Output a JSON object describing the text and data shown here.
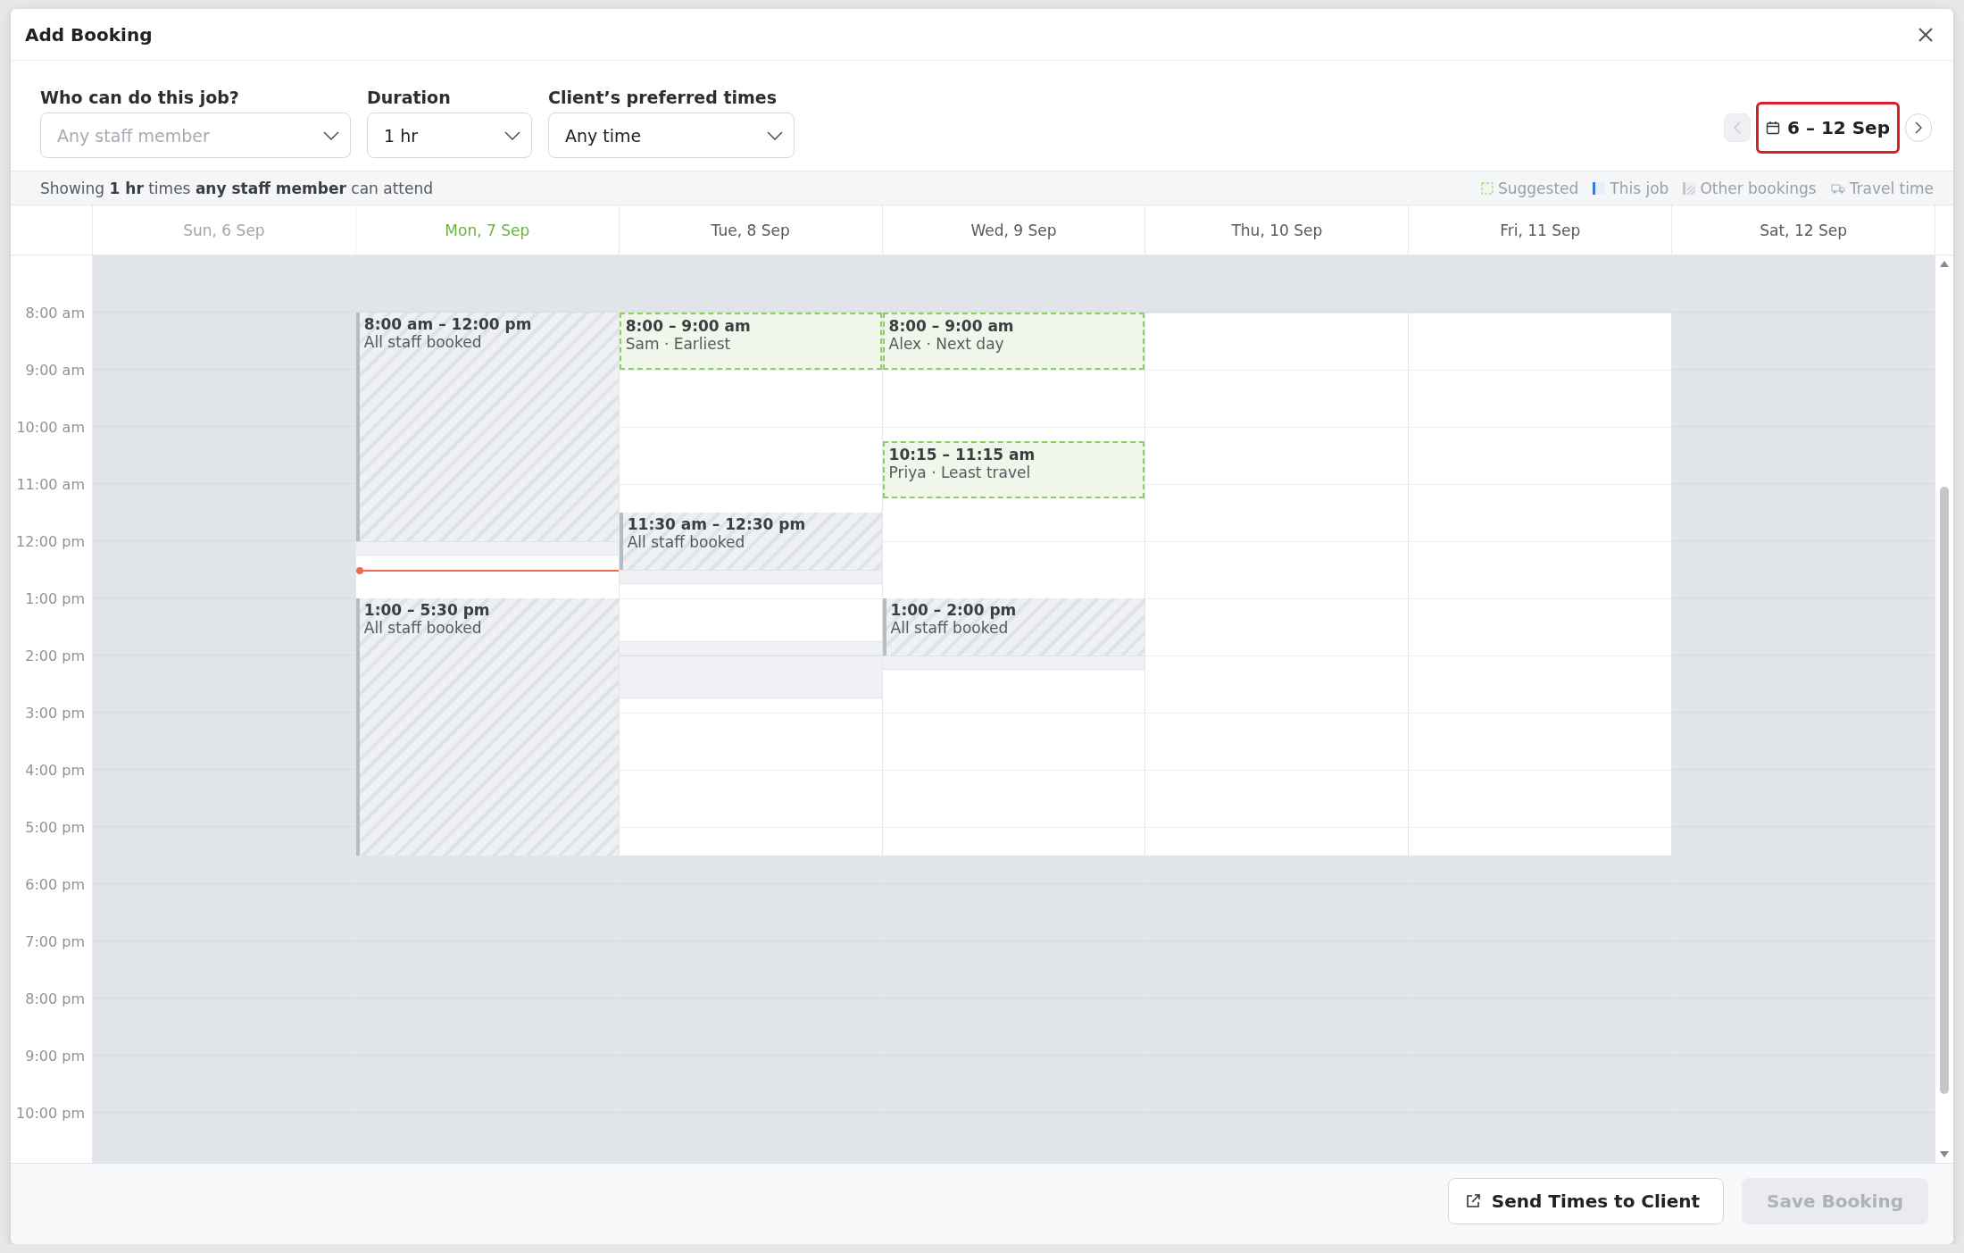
{
  "window": {
    "title": "Add Booking"
  },
  "filters": [
    {
      "kind": "select",
      "label": "Who can do this job?",
      "placeholder": "Any staff member"
    },
    {
      "kind": "select",
      "label": "Duration",
      "value": "1 hr"
    },
    {
      "kind": "select",
      "label": "Client’s preferred times",
      "value": "Any time"
    }
  ],
  "date_nav": {
    "range": "6 – 12 Sep",
    "prev_disabled": true,
    "highlighted": true
  },
  "info": "Showing **1 hr** times **any staff member** can attend",
  "legend": [
    {
      "kind": "suggested",
      "label": "Suggested"
    },
    {
      "kind": "this_job",
      "label": "This job"
    },
    {
      "kind": "other",
      "label": "Other bookings"
    },
    {
      "kind": "travel",
      "label": "Travel time"
    }
  ],
  "times": [
    "8:00 am",
    "9:00 am",
    "10:00 am",
    "11:00 am",
    "12:00 pm",
    "1:00 pm",
    "2:00 pm",
    "3:00 pm",
    "4:00 pm",
    "5:00 pm",
    "6:00 pm",
    "7:00 pm",
    "8:00 pm",
    "9:00 pm",
    "10:00 pm"
  ],
  "days": [
    {
      "label": "Sun, 6 Sep",
      "past": true,
      "today": false,
      "working": false
    },
    {
      "label": "Mon, 7 Sep",
      "past": false,
      "today": true,
      "working": true,
      "events": [
        {
          "kind": "booked",
          "time": "8:00 am – 12:00 pm",
          "text": "All staff booked"
        },
        {
          "kind": "travel"
        },
        {
          "kind": "now"
        },
        {
          "kind": "booked",
          "time": "1:00 – 5:30 pm",
          "text": "All staff booked"
        }
      ]
    },
    {
      "label": "Tue, 8 Sep",
      "past": false,
      "today": false,
      "working": true,
      "events": [
        {
          "kind": "suggested",
          "time": "8:00 – 9:00 am",
          "text": "Sam · Earliest"
        },
        {
          "kind": "booked",
          "time": "11:30 am – 12:30 pm",
          "text": "All staff booked"
        },
        {
          "kind": "travel"
        },
        {
          "kind": "travel"
        },
        {
          "kind": "travel"
        }
      ]
    },
    {
      "label": "Wed, 9 Sep",
      "past": false,
      "today": false,
      "working": true,
      "events": [
        {
          "kind": "suggested",
          "time": "8:00 – 9:00 am",
          "text": "Alex · Next day"
        },
        {
          "kind": "suggested",
          "time": "10:15 – 11:15 am",
          "text": "Priya · Least travel"
        },
        {
          "kind": "booked",
          "time": "1:00 – 2:00 pm",
          "text": "All staff booked"
        },
        {
          "kind": "travel"
        }
      ]
    },
    {
      "label": "Thu, 10 Sep",
      "past": false,
      "today": false,
      "working": true
    },
    {
      "label": "Fri, 11 Sep",
      "past": false,
      "today": false,
      "working": true
    },
    {
      "label": "Sat, 12 Sep",
      "past": false,
      "today": false,
      "working": false
    }
  ],
  "footer": {
    "send": "Send Times to Client",
    "save": "Save Booking",
    "save_disabled": true
  }
}
